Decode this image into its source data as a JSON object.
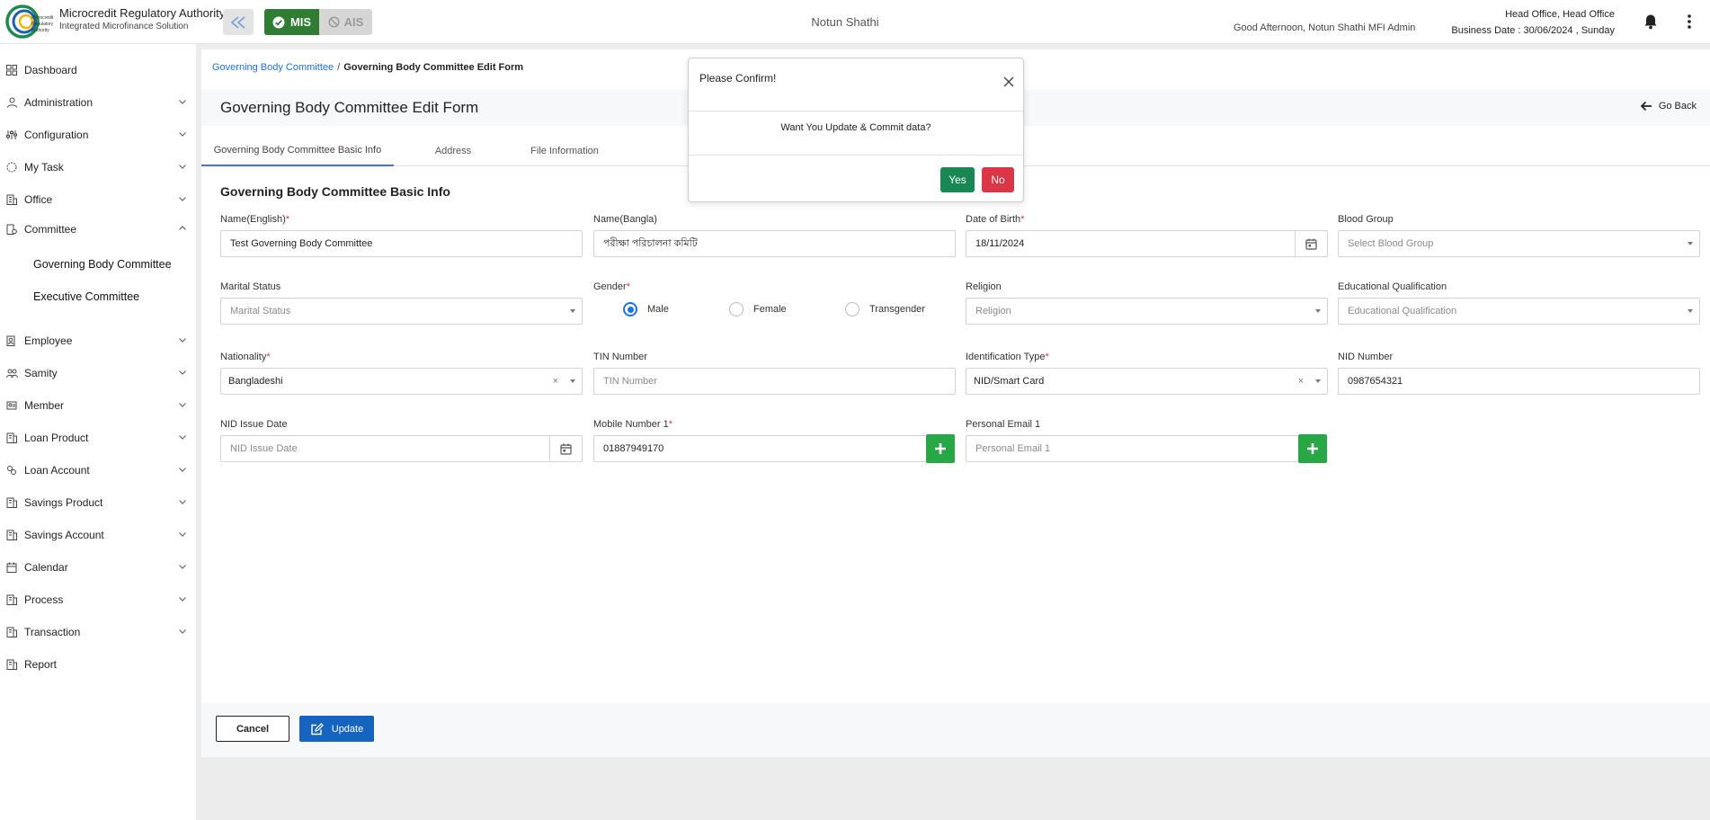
{
  "header": {
    "brand_title": "Microcredit Regulatory Authority",
    "brand_subtitle": "Integrated Microfinance Solution",
    "mode_mis": "MIS",
    "mode_ais": "AIS",
    "org_name": "Notun Shathi",
    "greeting": "Good Afternoon, Notun Shathi MFI Admin",
    "office": "Head Office, Head Office",
    "business_date": "Business Date : 30/06/2024 , Sunday"
  },
  "sidebar": {
    "items": [
      {
        "label": "Dashboard",
        "icon": "dashboard-icon"
      },
      {
        "label": "Administration",
        "icon": "admin-icon"
      },
      {
        "label": "Configuration",
        "icon": "sliders-icon"
      },
      {
        "label": "My Task",
        "icon": "task-icon"
      },
      {
        "label": "Office",
        "icon": "building-icon"
      },
      {
        "label": "Committee",
        "icon": "committee-icon"
      },
      {
        "label": "Employee",
        "icon": "employee-icon"
      },
      {
        "label": "Samity",
        "icon": "group-icon"
      },
      {
        "label": "Member",
        "icon": "member-icon"
      },
      {
        "label": "Loan Product",
        "icon": "loan-product-icon"
      },
      {
        "label": "Loan Account",
        "icon": "loan-account-icon"
      },
      {
        "label": "Savings Product",
        "icon": "savings-product-icon"
      },
      {
        "label": "Savings Account",
        "icon": "savings-account-icon"
      },
      {
        "label": "Calendar",
        "icon": "calendar-icon"
      },
      {
        "label": "Process",
        "icon": "process-icon"
      },
      {
        "label": "Transaction",
        "icon": "transaction-icon"
      },
      {
        "label": "Report",
        "icon": "report-icon"
      }
    ],
    "committee_sub": [
      "Governing Body Committee",
      "Executive Committee"
    ]
  },
  "breadcrumb": {
    "link": "Governing Body Committee",
    "separator": "/",
    "current": "Governing Body Committee Edit Form"
  },
  "page": {
    "title": "Governing Body Committee Edit Form",
    "go_back": "Go Back",
    "section_title": "Governing Body Committee Basic Info"
  },
  "tabs": [
    "Governing Body Committee Basic Info",
    "Address",
    "File Information"
  ],
  "form": {
    "name_en": {
      "label": "Name(English)",
      "value": "Test Governing Body Committee"
    },
    "name_bn": {
      "label": "Name(Bangla)",
      "value": "পরীক্ষা পরিচালনা কমিটি"
    },
    "dob": {
      "label": "Date of Birth",
      "value": "18/11/2024"
    },
    "blood_group": {
      "label": "Blood Group",
      "placeholder": "Select Blood Group"
    },
    "marital_status": {
      "label": "Marital Status",
      "placeholder": "Marital Status"
    },
    "gender": {
      "label": "Gender",
      "options": [
        "Male",
        "Female",
        "Transgender"
      ],
      "selected": "Male"
    },
    "religion": {
      "label": "Religion",
      "placeholder": "Religion"
    },
    "education": {
      "label": "Educational Qualification",
      "placeholder": "Educational Qualification"
    },
    "nationality": {
      "label": "Nationality",
      "value": "Bangladeshi"
    },
    "tin": {
      "label": "TIN Number",
      "placeholder": "TIN Number"
    },
    "id_type": {
      "label": "Identification Type",
      "value": "NID/Smart Card"
    },
    "nid": {
      "label": "NID Number",
      "value": "0987654321"
    },
    "nid_issue": {
      "label": "NID Issue Date",
      "placeholder": "NID Issue Date"
    },
    "mobile": {
      "label": "Mobile Number 1",
      "value": "01887949170"
    },
    "email": {
      "label": "Personal Email 1",
      "placeholder": "Personal Email 1"
    },
    "required_mark": "*",
    "clear_mark": "×"
  },
  "footer": {
    "cancel": "Cancel",
    "update": "Update"
  },
  "modal": {
    "title": "Please Confirm!",
    "message": "Want You Update & Commit data?",
    "yes": "Yes",
    "no": "No"
  },
  "colors": {
    "mis_green": "#2e7d32",
    "primary_blue": "#1565c0",
    "link_blue": "#1a73e8",
    "success": "#28a745",
    "danger": "#dc3545"
  }
}
